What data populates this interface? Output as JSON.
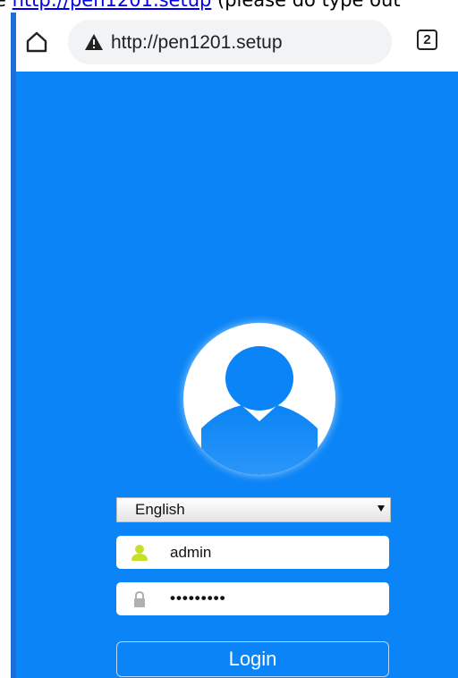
{
  "caption": {
    "prefix": "e ",
    "link_text": "http://pen1201.setup",
    "suffix": " (please do type out"
  },
  "browser": {
    "url": "http://pen1201.setup",
    "tab_count": "2",
    "icons": [
      "home-icon",
      "not-secure-warning-icon"
    ]
  },
  "login": {
    "language": "English",
    "username": "admin",
    "password_mask": "•••••••••",
    "button_label": "Login",
    "icons": [
      "avatar",
      "user-icon",
      "lock-icon"
    ]
  },
  "colors": {
    "background_blue": "#0a84f6",
    "user_icon": "#c6e02a",
    "lock_icon": "#b0b0b0"
  }
}
